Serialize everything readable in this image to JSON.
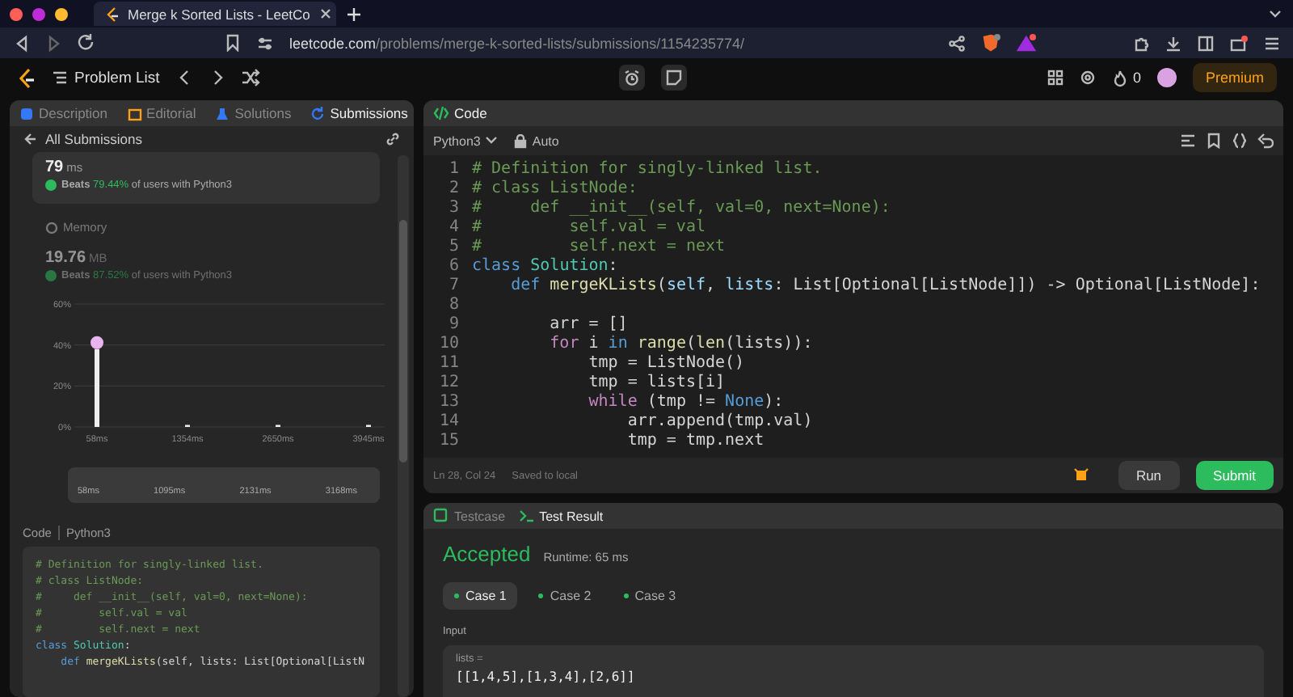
{
  "browser": {
    "tab_title": "Merge k Sorted Lists - LeetCo",
    "url_host": "leetcode.com",
    "url_path": "/problems/merge-k-sorted-lists/submissions/1154235774/"
  },
  "nav": {
    "problem_list": "Problem List",
    "streak": "0",
    "premium": "Premium"
  },
  "left_panel": {
    "tabs": [
      {
        "label": "Description",
        "selected": false
      },
      {
        "label": "Editorial",
        "selected": false
      },
      {
        "label": "Solutions",
        "selected": false
      },
      {
        "label": "Submissions",
        "selected": true
      }
    ],
    "back_link": "All Submissions",
    "runtime": {
      "value": "79",
      "unit": "ms",
      "beats": "Beats",
      "percent": "79.44%",
      "suffix": "of users with Python3"
    },
    "memory": {
      "label": "Memory",
      "value": "19.76",
      "unit": "MB",
      "beats": "Beats",
      "percent": "87.52%",
      "suffix": "of users with Python3"
    },
    "chart_data": {
      "type": "bar",
      "categories": [
        "58ms",
        "1354ms",
        "2650ms",
        "3945ms"
      ],
      "values": [
        38,
        1,
        1,
        1
      ],
      "ylim": [
        0,
        60
      ],
      "yticks": [
        {
          "value": 0,
          "label": "0%"
        },
        {
          "value": 20,
          "label": "20%"
        },
        {
          "value": 40,
          "label": "40%"
        },
        {
          "value": 60,
          "label": "60%"
        }
      ]
    },
    "navigator_labels": [
      "58ms",
      "1095ms",
      "2131ms",
      "3168ms"
    ],
    "code_label": "Code",
    "code_language": "Python3",
    "code_lines": [
      {
        "tokens": [
          {
            "kind": "comment",
            "text": "# Definition for singly-linked list."
          }
        ]
      },
      {
        "tokens": [
          {
            "kind": "comment",
            "text": "# class ListNode:"
          }
        ]
      },
      {
        "tokens": [
          {
            "kind": "comment",
            "text": "#     def __init__(self, val=0, next=None):"
          }
        ]
      },
      {
        "tokens": [
          {
            "kind": "comment",
            "text": "#         self.val = val"
          }
        ]
      },
      {
        "tokens": [
          {
            "kind": "comment",
            "text": "#         self.next = next"
          }
        ]
      },
      {
        "tokens": [
          {
            "kind": "keyword",
            "text": "class"
          },
          {
            "kind": "type",
            "text": " Solution"
          },
          {
            "kind": "plain",
            "text": ":"
          }
        ]
      },
      {
        "tokens": [
          {
            "kind": "keyword",
            "text": "    def"
          },
          {
            "kind": "function",
            "text": " mergeKLists"
          },
          {
            "kind": "plain",
            "text": "(self, lists: List[Optional[ListN"
          }
        ]
      }
    ]
  },
  "editor": {
    "title": "Code",
    "language": "Python3",
    "mode": "Auto",
    "lines": [
      {
        "num": "1",
        "tokens": [
          {
            "kind": "comment",
            "text": "# Definition for singly-linked list."
          }
        ]
      },
      {
        "num": "2",
        "tokens": [
          {
            "kind": "comment",
            "text": "# class ListNode:"
          }
        ]
      },
      {
        "num": "3",
        "tokens": [
          {
            "kind": "comment",
            "text": "#     def __init__(self, val=0, next=None):"
          }
        ]
      },
      {
        "num": "4",
        "tokens": [
          {
            "kind": "comment",
            "text": "#         self.val = val"
          }
        ]
      },
      {
        "num": "5",
        "tokens": [
          {
            "kind": "comment",
            "text": "#         self.next = next"
          }
        ]
      },
      {
        "num": "6",
        "tokens": [
          {
            "kind": "keyword",
            "text": "class"
          },
          {
            "kind": "type",
            "text": " Solution"
          },
          {
            "kind": "plain",
            "text": ":"
          }
        ]
      },
      {
        "num": "7",
        "tokens": [
          {
            "kind": "keyword",
            "text": "    def"
          },
          {
            "kind": "function",
            "text": " mergeKLists"
          },
          {
            "kind": "plain",
            "text": "("
          },
          {
            "kind": "variable",
            "text": "self"
          },
          {
            "kind": "plain",
            "text": ", "
          },
          {
            "kind": "variable",
            "text": "lists"
          },
          {
            "kind": "plain",
            "text": ": List[Optional[ListNode]]) -> Optional[ListNode]:"
          }
        ]
      },
      {
        "num": "8"
      },
      {
        "num": "9",
        "tokens": [
          {
            "kind": "plain",
            "text": "        arr = []"
          }
        ]
      },
      {
        "num": "10",
        "tokens": [
          {
            "kind": "control",
            "text": "        for"
          },
          {
            "kind": "plain",
            "text": " i "
          },
          {
            "kind": "keyword",
            "text": "in"
          },
          {
            "kind": "function",
            "text": " range"
          },
          {
            "kind": "plain",
            "text": "("
          },
          {
            "kind": "function",
            "text": "len"
          },
          {
            "kind": "plain",
            "text": "(lists)):"
          }
        ]
      },
      {
        "num": "11",
        "tokens": [
          {
            "kind": "plain",
            "text": "            tmp = ListNode()"
          }
        ]
      },
      {
        "num": "12",
        "tokens": [
          {
            "kind": "plain",
            "text": "            tmp = lists[i]"
          }
        ]
      },
      {
        "num": "13",
        "tokens": [
          {
            "kind": "control",
            "text": "            while"
          },
          {
            "kind": "plain",
            "text": " (tmp != "
          },
          {
            "kind": "keyword",
            "text": "None"
          },
          {
            "kind": "plain",
            "text": "):"
          }
        ]
      },
      {
        "num": "14",
        "tokens": [
          {
            "kind": "plain",
            "text": "                arr.append(tmp.val)"
          }
        ]
      },
      {
        "num": "15",
        "tokens": [
          {
            "kind": "plain",
            "text": "                tmp = tmp.next"
          }
        ]
      }
    ],
    "cursor": "Ln 28, Col 24",
    "saved": "Saved to local",
    "run": "Run",
    "submit": "Submit"
  },
  "result_panel": {
    "tabs": [
      {
        "label": "Testcase",
        "selected": false
      },
      {
        "label": "Test Result",
        "selected": true
      }
    ],
    "status": "Accepted",
    "runtime": "Runtime: 65 ms",
    "cases": [
      {
        "label": "Case 1",
        "selected": true
      },
      {
        "label": "Case 2",
        "selected": false
      },
      {
        "label": "Case 3",
        "selected": false
      }
    ],
    "input_label": "Input",
    "var_name": "lists =",
    "var_value": "[[1,4,5],[1,3,4],[2,6]]"
  }
}
